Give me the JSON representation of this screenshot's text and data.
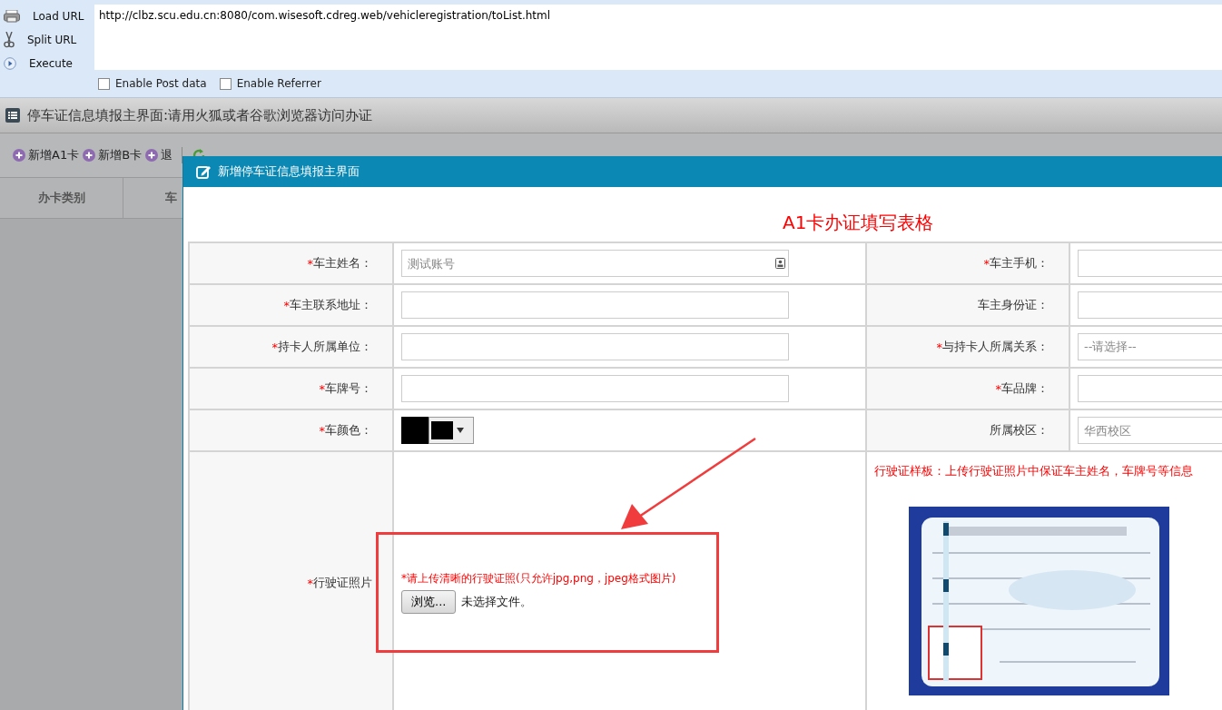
{
  "hackbar": {
    "actions": [
      {
        "kind": "load",
        "label": "Load URL"
      },
      {
        "kind": "split",
        "label": "Split URL"
      },
      {
        "kind": "execute",
        "label": "Execute"
      }
    ],
    "url": "http://clbz.scu.edu.cn:8080/com.wisesoft.cdreg.web/vehicleregistration/toList.html",
    "options": [
      {
        "label": "Enable Post data",
        "checked": false
      },
      {
        "label": "Enable Referrer",
        "checked": false
      }
    ]
  },
  "page": {
    "title": "停车证信息填报主界面:请用火狐或者谷歌浏览器访问办证",
    "toolbar": [
      {
        "kind": "add",
        "label": "新增A1卡"
      },
      {
        "kind": "add",
        "label": "新增B卡"
      },
      {
        "kind": "add",
        "label": "退"
      },
      {
        "kind": "refresh"
      }
    ],
    "table": {
      "columns": [
        "办卡类别",
        "车"
      ]
    }
  },
  "dialog": {
    "title": "新增停车证信息填报主界面",
    "heading": "A1卡办证填写表格",
    "rows": [
      [
        {
          "mark": "*",
          "label": "车主姓名：",
          "kind": "text",
          "placeholder": "测试账号",
          "contact_icon": true
        },
        {
          "mark": "*",
          "label": "车主手机：",
          "kind": "text"
        }
      ],
      [
        {
          "mark": "*",
          "label": "车主联系地址：",
          "kind": "text"
        },
        {
          "label": "车主身份证：",
          "kind": "text"
        }
      ],
      [
        {
          "mark": "*",
          "label": "持卡人所属单位：",
          "kind": "text"
        },
        {
          "mark": "*",
          "label": "与持卡人所属关系：",
          "kind": "select",
          "placeholder": "--请选择--"
        }
      ],
      [
        {
          "mark": "*",
          "label": "车牌号：",
          "kind": "text"
        },
        {
          "mark": "*",
          "label": "车品牌：",
          "kind": "text"
        }
      ],
      [
        {
          "mark": "*",
          "label": "车颜色：",
          "kind": "color",
          "color": "#000000"
        },
        {
          "label": "所属校区：",
          "kind": "text",
          "placeholder": "华西校区"
        }
      ]
    ],
    "upload": {
      "mark": "*",
      "label": "行驶证照片",
      "hint": "*请上传清晰的行驶证照(只允许jpg,png，jpeg格式图片)",
      "button": "浏览...",
      "status": "未选择文件。"
    },
    "sample": {
      "note": "行驶证样板：上传行驶证照片中保证车主姓名，车牌号等信息"
    }
  }
}
